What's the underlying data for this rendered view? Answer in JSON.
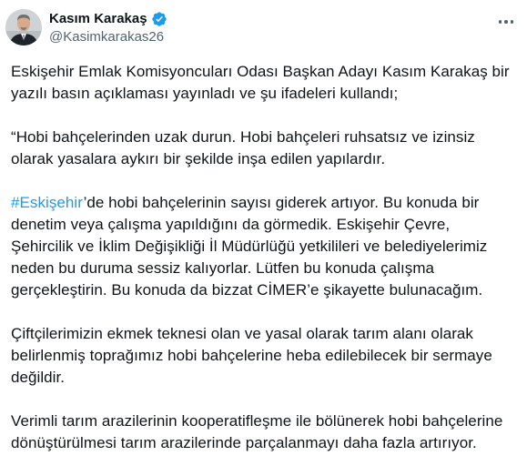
{
  "author": {
    "display_name": "Kasım Karakaş",
    "handle": "@Kasimkarakas26",
    "verified": true,
    "avatar_icon": "portrait-photo-icon",
    "verified_icon": "verified-badge-icon",
    "more_icon": "more-options-icon"
  },
  "colors": {
    "text": "#0f1419",
    "secondary": "#536471",
    "link": "#1d9bf0",
    "verified": "#1d9bf0"
  },
  "tweet": {
    "p1": "Eskişehir Emlak Komisyoncuları Odası Başkan Adayı Kasım Karakaş bir yazılı basın açıklaması yayınladı ve şu ifadeleri kullandı;",
    "p2": "“Hobi bahçelerinden uzak durun. Hobi bahçeleri ruhsatsız ve izinsiz olarak yasalara aykırı bir şekilde inşa edilen yapılardır.",
    "p3_hashtag": "#Eskişehir",
    "p3_rest": "’de hobi bahçelerinin sayısı giderek artıyor. Bu konuda bir denetim veya çalışma yapıldığını da görmedik. Eskişehir Çevre, Şehircilik ve İklim Değişikliği İl Müdürlüğü yetkilileri ve belediyelerimiz neden bu duruma sessiz kalıyorlar. Lütfen bu konuda çalışma gerçekleştirin. Bu konuda da bizzat CİMER’e şikayette bulunacağım.",
    "p4": "Çiftçilerimizin ekmek teknesi olan ve yasal olarak tarım alanı olarak belirlenmiş toprağımız hobi bahçelerine heba edilebilecek bir sermaye değildir.",
    "p5": "Verimli tarım arazilerinin kooperatifleşme ile bölünerek hobi bahçelerine dönüştürülmesi tarım arazilerinde parçalanmayı daha fazla artırıyor."
  }
}
